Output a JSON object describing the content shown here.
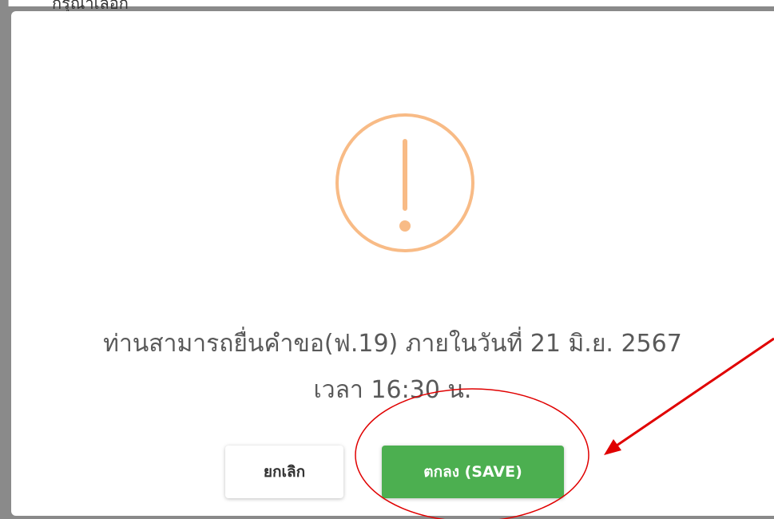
{
  "background": {
    "partial_text": "กรุณาเลือก"
  },
  "dialog": {
    "icon": "warning-exclamation-icon",
    "icon_color": "#f8bb86",
    "message_line1": "ท่านสามารถยื่นคำขอ(ฟ.19) ภายในวันที่ 21 มิ.ย. 2567",
    "message_line2": "เวลา 16:30 น.",
    "cancel_label": "ยกเลิก",
    "confirm_label": "ตกลง (SAVE)",
    "confirm_color": "#4caf50"
  },
  "annotation": {
    "color": "#e00000",
    "shapes": [
      "ellipse-around-confirm",
      "arrow-pointing-to-confirm"
    ]
  }
}
